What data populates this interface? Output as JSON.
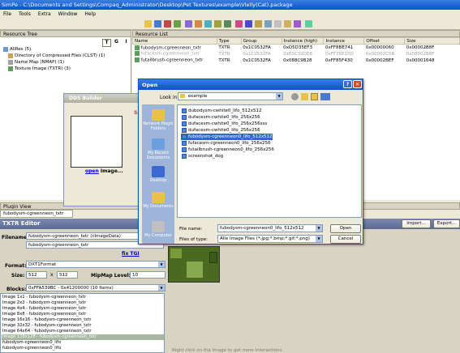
{
  "window": {
    "title": "SimPe - C:\\Documents and Settings\\Compaq_Administrator\\Desktop\\Pet Textures\\example\\Vlelly(Cat).package"
  },
  "menu": [
    "File",
    "Tools",
    "Extra",
    "Window",
    "Help"
  ],
  "resource_tree": {
    "header": "Resource Tree",
    "buttons": [
      "T",
      "G",
      "I"
    ],
    "items": [
      "AllRes (5)",
      "Directory of Compressed Files (CLST) (1)",
      "Name Map (NMAP) (1)",
      "Texture Image (TXTR) (3)"
    ]
  },
  "resource_list": {
    "header": "Resource List",
    "columns": [
      "Name",
      "Type",
      "Group",
      "Instance (high)",
      "Instance",
      "Offset",
      "Size"
    ],
    "rows": [
      [
        "fubodysm-cgreenneon_txtr",
        "TXTR",
        "0x1C0532FA",
        "0xD5D35EF3",
        "0xFF8BE741",
        "0x00000060",
        "0x00002B8F"
      ],
      [
        "fufacesm-cgreenneon_txtr",
        "TXTR",
        "0x1C0532FA",
        "0xE0C39DE8",
        "0xFF75E15D",
        "0x00002C5B",
        "0x00002B8F"
      ],
      [
        "futailbrush-cgreenneon_txtr",
        "TXTR",
        "0x1C0532FA",
        "0x088C9B28",
        "0xFF85F430",
        "0x00002BEF",
        "0x00001648"
      ]
    ]
  },
  "dds_builder": {
    "title": "DDS Builder",
    "open_link": "open",
    "open_suffix": "Image...",
    "side_label": "Sc"
  },
  "plugin_view": {
    "header": "Plugin View",
    "tab": "fubodysm-cgreenneon_txtr"
  },
  "txtr_editor": {
    "title": "TXTR Editor",
    "filename_label": "Filename:",
    "filename_value": "fubodysm-cgreenneon_txtr (cImageData)",
    "filename_value2": "fubodysm-cgreenneon_txtr",
    "fix_tgi": "fix TGI",
    "format_label": "Format:",
    "format_value": "DXT1Format",
    "size_label": "Size:",
    "size_w": "512",
    "size_x": "x",
    "size_h": "512",
    "mipmap_label": "MipMap Level:",
    "mipmap_value": "10",
    "blocks_label": "Blocks:",
    "blocks_value": "0xFFA539BC - 0x41200000 (10 Items)",
    "block_items": [
      "Image 1x1 - fubodysm-cgreenneon_txtr",
      "Image 2x2 - fubodysm-cgreenneon_txtr",
      "Image 4x4 - fubodysm-cgreenneon_txtr",
      "Image 8x8 - fubodysm-cgreenneon_txtr",
      "Image 16x16 - fubodysm-cgreenneon_txtr",
      "Image 32x32 - fubodysm-cgreenneon_txtr",
      "Image 64x64 - fubodysm-cgreenneon_txtr",
      "Image 128x128 - fubodysm-cgreenneon_txtr",
      "fubodysm-cgreenneon0_lifo",
      "fubodysm-cgreenneon0_lifo"
    ],
    "selected_block": 7,
    "import_button": "Import...",
    "export_button": "Export...",
    "hint": "Right click on the Image to get more Interactions."
  },
  "open_dialog": {
    "title": "Open",
    "look_in_label": "Look in:",
    "look_in_value": "example",
    "places": [
      "Network Magic Folders",
      "My Recent Documents",
      "Desktop",
      "My Documents",
      "My Computer"
    ],
    "files": [
      "dubodysm-cwhite0_lifo_512x512",
      "dufacesm-cwhite0_lifo_256x256",
      "dufacesm-cwhite0_lifo_256x256sss",
      "dufacesm-cwhite0_lifo_256x256",
      "fubodysm-cgreenneon0_lifo_512x512",
      "fufacesm-cgreenneon0_lifo_256x256",
      "futailbrush-cgreenneon0_lifo_256x256",
      "screenshot_dog"
    ],
    "selected_file": 4,
    "filename_label": "File name:",
    "filename_value": "fubodysm-cgreenneon0_lifo_512x512",
    "filetype_label": "Files of type:",
    "filetype_value": "Alle Image Files (*.jpg;*.bmp;*.gif;*.png)",
    "open_button": "Open",
    "cancel_button": "Cancel"
  },
  "colors": {
    "titlebar": "#0a53c9",
    "selection": "#316ac5",
    "link": "#0000cc"
  }
}
